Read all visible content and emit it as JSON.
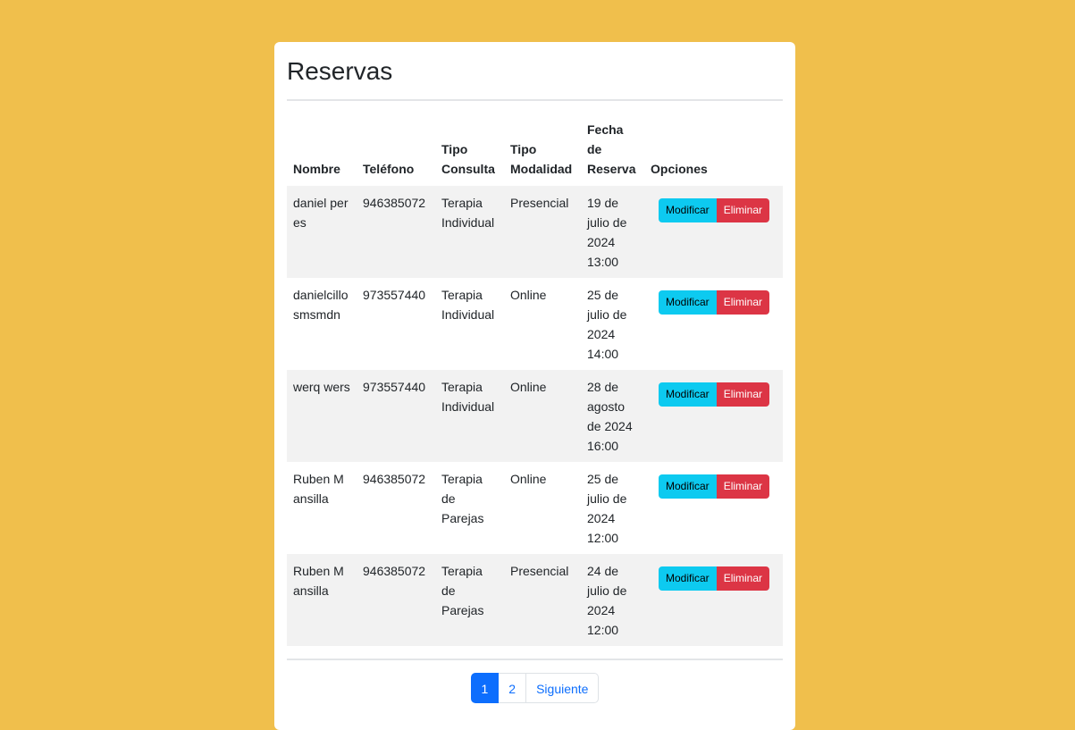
{
  "title": "Reservas",
  "headers": {
    "nombre": "Nombre",
    "telefono": "Teléfono",
    "tipo_consulta": "Tipo Consulta",
    "tipo_modalidad": "Tipo Modalidad",
    "fecha_reserva": "Fecha de Reserva",
    "opciones": "Opciones"
  },
  "rows": [
    {
      "nombre": "daniel peres",
      "telefono": "946385072",
      "tipo_consulta": "Terapia Individual",
      "tipo_modalidad": "Presencial",
      "fecha_reserva": "19 de julio de 2024 13:00"
    },
    {
      "nombre": "danielcillosmsmdn",
      "telefono": "973557440",
      "tipo_consulta": "Terapia Individual",
      "tipo_modalidad": "Online",
      "fecha_reserva": "25 de julio de 2024 14:00"
    },
    {
      "nombre": "werq wers",
      "telefono": "973557440",
      "tipo_consulta": "Terapia Individual",
      "tipo_modalidad": "Online",
      "fecha_reserva": "28 de agosto de 2024 16:00"
    },
    {
      "nombre": "Ruben Mansilla",
      "telefono": "946385072",
      "tipo_consulta": "Terapia de Parejas",
      "tipo_modalidad": "Online",
      "fecha_reserva": "25 de julio de 2024 12:00"
    },
    {
      "nombre": "Ruben Mansilla",
      "telefono": "946385072",
      "tipo_consulta": "Terapia de Parejas",
      "tipo_modalidad": "Presencial",
      "fecha_reserva": "24 de julio de 2024 12:00"
    }
  ],
  "actions": {
    "modify_label": "Modificar",
    "delete_label": "Eliminar"
  },
  "pagination": {
    "pages": [
      "1",
      "2"
    ],
    "next_label": "Siguiente",
    "active_page": "1"
  },
  "colors": {
    "background": "#f0bf4c",
    "modify_button": "#0dcaf0",
    "delete_button": "#dc3545",
    "active_page": "#0d6efd"
  }
}
